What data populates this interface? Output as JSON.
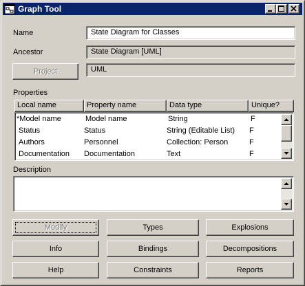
{
  "window": {
    "title": "Graph Tool",
    "titlebar_color": "#0a246a",
    "face_color": "#d4d0c8"
  },
  "icons": {
    "app": "graph-tool-icon",
    "minimize": "minimize-icon",
    "maximize": "maximize-icon",
    "close": "close-icon",
    "scroll_up": "scroll-up-arrow-icon",
    "scroll_down": "scroll-down-arrow-icon"
  },
  "form": {
    "name_label": "Name",
    "name_value": "State Diagram for Classes",
    "ancestor_label": "Ancestor",
    "ancestor_value": "State Diagram [UML]",
    "project_button": "Project",
    "project_value": "UML",
    "properties_label": "Properties",
    "description_label": "Description",
    "description_value": ""
  },
  "properties": {
    "columns": [
      "Local name",
      "Property name",
      "Data type",
      "Unique?"
    ],
    "rows": [
      [
        "*Model name",
        "Model name",
        "String",
        "F"
      ],
      [
        "Status",
        "Status",
        "String (Editable List)",
        "F"
      ],
      [
        "Authors",
        "Personnel",
        "Collection: Person",
        "F"
      ],
      [
        "Documentation",
        "Documentation",
        "Text",
        "F"
      ]
    ]
  },
  "buttons": {
    "modify": "Modify",
    "types": "Types",
    "explosions": "Explosions",
    "info": "Info",
    "bindings": "Bindings",
    "decompositions": "Decompositions",
    "help": "Help",
    "constraints": "Constraints",
    "reports": "Reports"
  }
}
